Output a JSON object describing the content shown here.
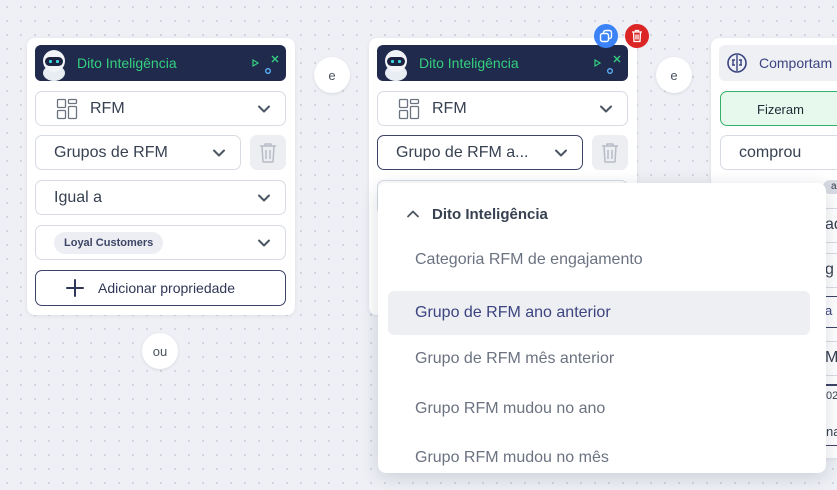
{
  "brand_color": "#35d07f",
  "accent_color": "#3b4480",
  "card1": {
    "header_title": "Dito Inteligência",
    "property_label": "RFM",
    "sub_property": "Grupos de RFM",
    "operator": "Igual a",
    "value_tag": "Loyal Customers",
    "add_property_label": "Adicionar propriedade"
  },
  "connector_e1": "e",
  "connector_ou": "ou",
  "card2": {
    "header_title": "Dito Inteligência",
    "property_label": "RFM",
    "sub_property": "Grupo de RFM a..."
  },
  "connector_e2": "e",
  "card3": {
    "header_title": "Comportam",
    "event_chip": "Fizeram",
    "event_value": "comprou",
    "partial_texts": [
      "a",
      "ad",
      "g",
      "a",
      "Me",
      "02",
      "na"
    ]
  },
  "dropdown": {
    "group_label": "Dito Inteligência",
    "items": [
      "Categoria RFM de engajamento",
      "Grupo de RFM ano anterior",
      "Grupo de RFM mês anterior",
      "Grupo RFM mudou no ano",
      "Grupo RFM mudou no mês"
    ],
    "selected_index": 1
  }
}
